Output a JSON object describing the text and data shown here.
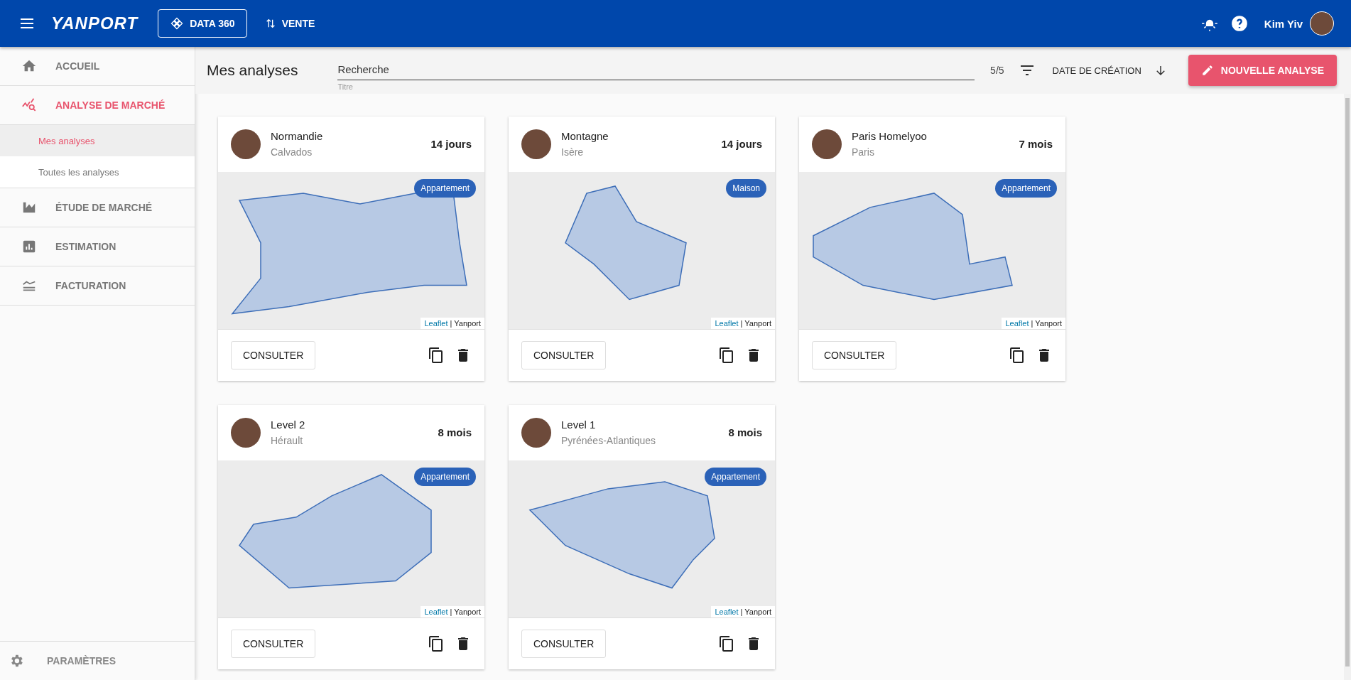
{
  "header": {
    "logo": "YANPORT",
    "nav": [
      {
        "label": "DATA 360",
        "selected": true
      },
      {
        "label": "VENTE",
        "selected": false
      }
    ],
    "user": "Kim Yiv"
  },
  "sidebar": {
    "items": [
      {
        "label": "ACCUEIL",
        "selected": false
      },
      {
        "label": "ANALYSE DE MARCHÉ",
        "selected": true,
        "expanded": true,
        "children": [
          {
            "label": "Mes analyses",
            "selected": true
          },
          {
            "label": "Toutes les analyses",
            "selected": false
          }
        ]
      },
      {
        "label": "ÉTUDE DE MARCHÉ",
        "selected": false
      },
      {
        "label": "ESTIMATION",
        "selected": false
      },
      {
        "label": "FACTURATION",
        "selected": false
      }
    ],
    "footer": "PARAMÈTRES"
  },
  "toolbar": {
    "title": "Mes analyses",
    "search": {
      "placeholder": "Recherche",
      "helper": "Titre"
    },
    "count": "5/5",
    "sort": "DATE DE CRÉATION",
    "new_button": "NOUVELLE ANALYSE"
  },
  "cards": [
    {
      "title": "Normandie",
      "subtitle": "Calvados",
      "age": "14 jours",
      "badge": "Appartement",
      "link": "Leaflet",
      "attribution": "| Yanport",
      "button": "CONSULTER"
    },
    {
      "title": "Montagne",
      "subtitle": "Isère",
      "age": "14 jours",
      "badge": "Maison",
      "link": "Leaflet",
      "attribution": "| Yanport",
      "button": "CONSULTER"
    },
    {
      "title": "Paris Homelyoo",
      "subtitle": "Paris",
      "age": "7 mois",
      "badge": "Appartement",
      "link": "Leaflet",
      "attribution": "| Yanport",
      "button": "CONSULTER"
    },
    {
      "title": "Level 2",
      "subtitle": "Hérault",
      "age": "8 mois",
      "badge": "Appartement",
      "link": "Leaflet",
      "attribution": "| Yanport",
      "button": "CONSULTER"
    },
    {
      "title": "Level 1",
      "subtitle": "Pyrénées-Atlantiques",
      "age": "8 mois",
      "badge": "Appartement",
      "link": "Leaflet",
      "attribution": "| Yanport",
      "button": "CONSULTER"
    }
  ]
}
